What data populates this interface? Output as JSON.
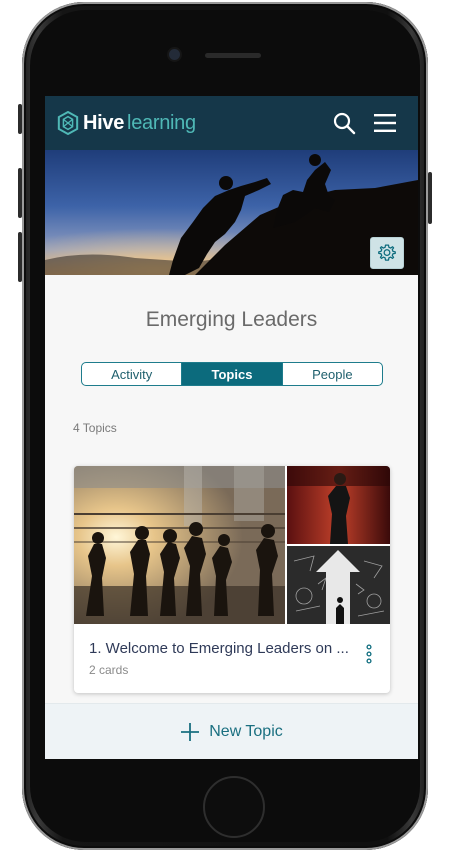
{
  "app": {
    "brand_bold": "Hive",
    "brand_light": "learning",
    "icons": [
      "hexagon-logo-icon",
      "search-icon",
      "hamburger-menu-icon",
      "gear-icon",
      "more-vertical-icon",
      "plus-icon"
    ]
  },
  "colors": {
    "topbar": "#153749",
    "accent": "#0c6b7d",
    "brand_teal": "#4fb8b6",
    "title_text": "#2f3a58"
  },
  "group": {
    "title": "Emerging Leaders"
  },
  "tabs": [
    {
      "label": "Activity",
      "active": false
    },
    {
      "label": "Topics",
      "active": true
    },
    {
      "label": "People",
      "active": false
    }
  ],
  "topics": {
    "count_label": "4 Topics",
    "items": [
      {
        "title": "1. Welcome to Emerging Leaders on ...",
        "subtitle": "2 cards"
      }
    ]
  },
  "footer": {
    "new_topic_label": "New Topic"
  }
}
